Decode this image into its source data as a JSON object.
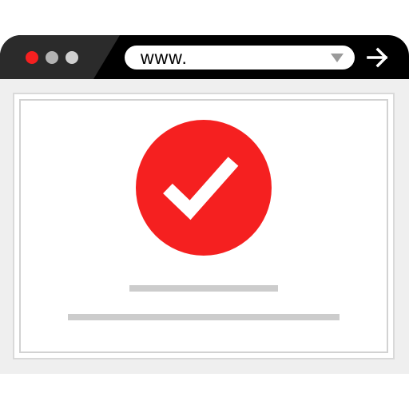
{
  "colors": {
    "titlebar": "#000000",
    "tab": "#2b2b2b",
    "close_dot": "#f52020",
    "inactive_dot": "#b3b3b3",
    "accent_red": "#f52020",
    "check_white": "#ffffff",
    "placeholder": "#cccccc"
  },
  "titlebar": {
    "controls": [
      "close-dot",
      "minimize-dot",
      "maximize-dot"
    ]
  },
  "address_bar": {
    "url": "www.",
    "dropdown_icon": "triangle-down-icon",
    "go_icon": "arrow-right-icon"
  },
  "content": {
    "status_icon": "checkmark-circle-icon",
    "placeholder_lines": 2
  }
}
